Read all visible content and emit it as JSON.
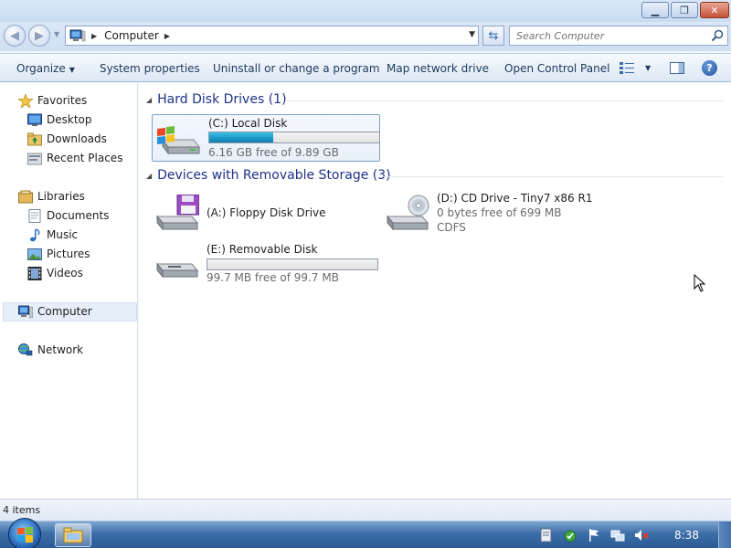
{
  "window": {
    "caption_buttons": [
      "minimize",
      "maximize",
      "close"
    ]
  },
  "address": {
    "location": "Computer",
    "search_placeholder": "Search Computer"
  },
  "toolbar": {
    "organize": "Organize",
    "system_properties": "System properties",
    "uninstall": "Uninstall or change a program",
    "map_drive": "Map network drive",
    "control_panel": "Open Control Panel"
  },
  "nav": {
    "favorites": "Favorites",
    "desktop": "Desktop",
    "downloads": "Downloads",
    "recent_places": "Recent Places",
    "libraries": "Libraries",
    "documents": "Documents",
    "music": "Music",
    "pictures": "Pictures",
    "videos": "Videos",
    "computer": "Computer",
    "network": "Network"
  },
  "content": {
    "hard_disk_group": "Hard Disk Drives (1)",
    "removable_group": "Devices with Removable Storage (3)",
    "drives": {
      "c": {
        "name": "(C:) Local Disk",
        "free": "6.16 GB free of 9.89 GB",
        "used_fraction": 0.377
      },
      "a": {
        "name": "(A:) Floppy Disk Drive"
      },
      "d": {
        "name": "(D:) CD Drive - Tiny7 x86 R1",
        "free": "0 bytes free of 699 MB",
        "fs": "CDFS"
      },
      "e": {
        "name": "(E:) Removable Disk",
        "free": "99.7 MB free of 99.7 MB",
        "used_fraction": 0.0
      }
    }
  },
  "status": {
    "items": "4 items"
  },
  "taskbar": {
    "clock": "8:38"
  },
  "colors": {
    "accent": "#1e3287",
    "bar_fill": "#1b98c6"
  }
}
